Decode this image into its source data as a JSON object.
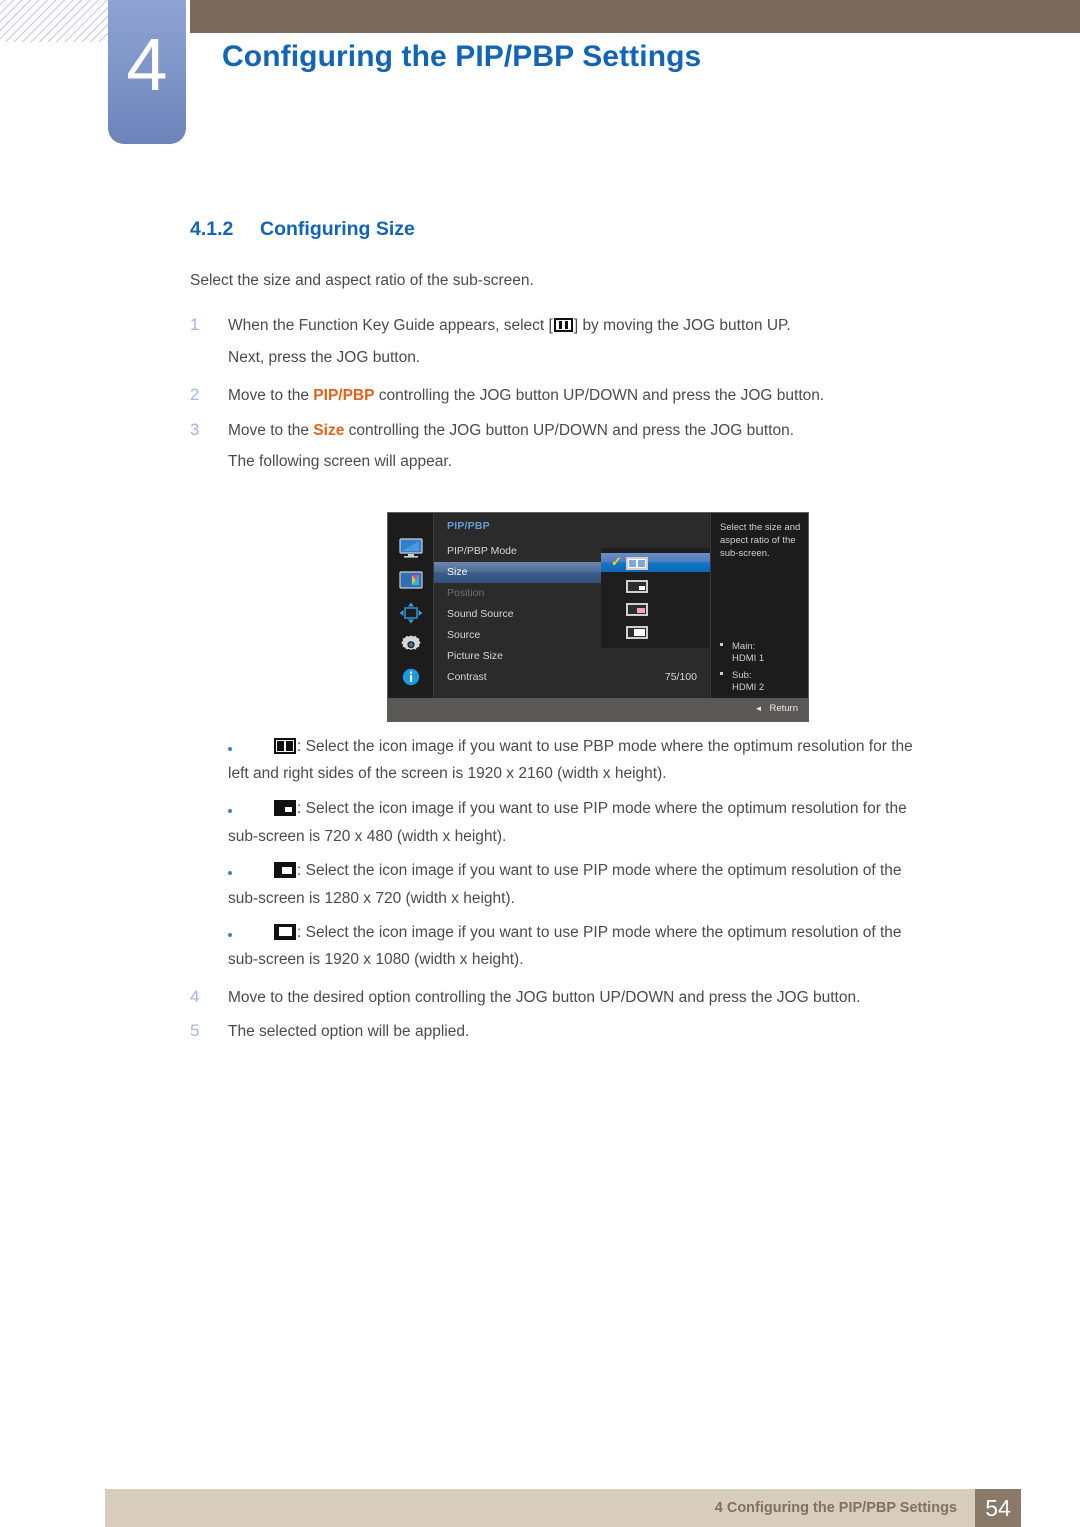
{
  "header": {
    "chapter_number": "4",
    "chapter_title": "Configuring the PIP/PBP Settings",
    "accent_blue": "#1265b5",
    "tab_blue": "#7c93c6",
    "bar_brown": "#7b6a5c"
  },
  "section": {
    "number": "4.1.2",
    "title": "Configuring Size",
    "intro": "Select the size and aspect ratio of the sub-screen."
  },
  "steps": [
    {
      "n": "1",
      "pre": "When the Function Key Guide appears, select [",
      "post": "] by moving the JOG button UP.",
      "cont": "Next, press the JOG button."
    },
    {
      "n": "2",
      "pre": "Move to the ",
      "highlight": "PIP/PBP",
      "post": " controlling the JOG button UP/DOWN and press the JOG button."
    },
    {
      "n": "3",
      "pre": "Move to the ",
      "highlight": "Size",
      "post": " controlling the JOG button UP/DOWN and press the JOG button.",
      "cont": "The following screen will appear."
    },
    {
      "n": "4",
      "pre": "Move to the desired option controlling the JOG button UP/DOWN and press the JOG button."
    },
    {
      "n": "5",
      "pre": "The selected option will be applied."
    }
  ],
  "osd": {
    "menu_title": "PIP/PBP",
    "rail_icons": [
      "monitor-icon",
      "picture-icon",
      "pip-pbp-icon",
      "gear-icon",
      "info-icon"
    ],
    "rows": [
      {
        "label": "PIP/PBP Mode",
        "value": "",
        "state": "normal"
      },
      {
        "label": "Size",
        "value": "",
        "state": "selected"
      },
      {
        "label": "Position",
        "value": "",
        "state": "disabled"
      },
      {
        "label": "Sound Source",
        "value": "",
        "state": "normal"
      },
      {
        "label": "Source",
        "value": "",
        "state": "normal"
      },
      {
        "label": "Picture Size",
        "value": "",
        "state": "normal"
      },
      {
        "label": "Contrast",
        "value": "75/100",
        "state": "normal"
      }
    ],
    "size_options": [
      {
        "icon": "pbp-split-icon",
        "checked": true
      },
      {
        "icon": "pip-small-icon",
        "checked": false
      },
      {
        "icon": "pip-medium-icon",
        "checked": false
      },
      {
        "icon": "pip-large-icon",
        "checked": false
      }
    ],
    "info": {
      "description": "Select the size and aspect ratio of the sub-screen.",
      "items": [
        {
          "label": "Main:",
          "value": "HDMI 1"
        },
        {
          "label": "Sub:",
          "value": "HDMI 2"
        }
      ]
    },
    "return_label": "Return"
  },
  "bullets": [
    {
      "icon": "pbp-split-icon",
      "line1": ": Select the icon image if you want to use PBP mode where the optimum resolution for the",
      "line2": "left and right sides of the screen is 1920 x 2160 (width x height)."
    },
    {
      "icon": "pip-small-icon",
      "line1": ": Select the icon image if you want to use PIP mode where the optimum resolution for the",
      "line2": "sub-screen is 720 x 480 (width x height)."
    },
    {
      "icon": "pip-medium-icon",
      "line1": ": Select the icon image if you want to use PIP mode where the optimum resolution of the",
      "line2": "sub-screen is 1280 x 720 (width x height)."
    },
    {
      "icon": "pip-large-icon",
      "line1": ": Select the icon image if you want to use PIP mode where the optimum resolution of the",
      "line2": "sub-screen is 1920 x 1080 (width x height)."
    }
  ],
  "footer": {
    "text": "4 Configuring the PIP/PBP Settings",
    "page": "54"
  }
}
